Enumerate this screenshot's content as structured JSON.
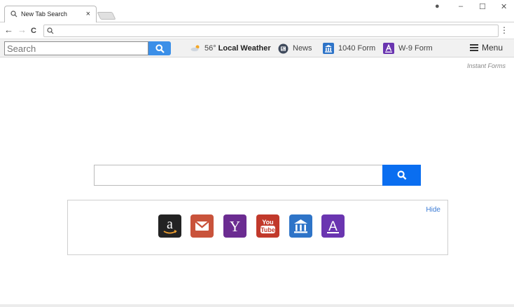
{
  "browser": {
    "tab_title": "New Tab Search",
    "tab_close": "×",
    "controls": {
      "profile": "●",
      "minimize": "–",
      "maximize": "☐",
      "close": "✕"
    },
    "back": "←",
    "forward": "→",
    "reload": "C",
    "url": "",
    "menu_dots": "⋮"
  },
  "extension_bar": {
    "search_placeholder": "Search",
    "weather_temp": "56°",
    "weather_label": "Local Weather",
    "news_label": "News",
    "form1040_label": "1040 Form",
    "w9_label": "W-9 Form",
    "menu_label": "Menu"
  },
  "main": {
    "instant_forms": "Instant Forms",
    "hide_label": "Hide",
    "tiles": [
      {
        "name": "amazon-icon",
        "color": "#232323"
      },
      {
        "name": "gmail-icon",
        "color": "#c9533b"
      },
      {
        "name": "yahoo-icon",
        "color": "#6b2c91"
      },
      {
        "name": "youtube-icon",
        "color": "#c1392b"
      },
      {
        "name": "bank-icon",
        "color": "#2e74c8"
      },
      {
        "name": "form-a-icon",
        "color": "#6a35b0"
      }
    ],
    "tile_text": {
      "amazon": "a",
      "yahoo": "Y",
      "youtube_top": "You",
      "youtube_bottom": "Tube",
      "form": "A"
    }
  },
  "colors": {
    "accent": "#0a6ef0",
    "ext_search_btn": "#3b8fe8"
  }
}
